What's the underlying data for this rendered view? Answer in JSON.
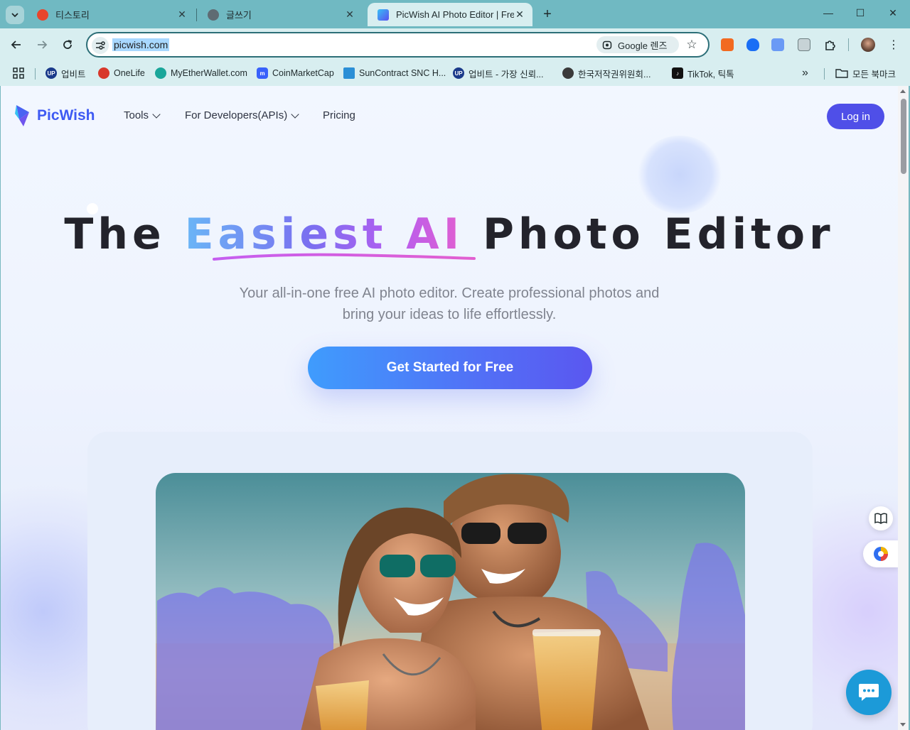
{
  "browser": {
    "tabs": [
      {
        "title": "티스토리",
        "favicon_color": "#e8452c"
      },
      {
        "title": "글쓰기",
        "favicon_color": "#5f6b73"
      },
      {
        "title": "PicWish AI Photo Editor | Free",
        "favicon_color": "#4f6df0"
      }
    ],
    "address": {
      "url": "picwish.com",
      "lens_label": "Google 렌즈"
    },
    "bookmarks": [
      {
        "label": "업비트",
        "icon_color": "#1a3a8a"
      },
      {
        "label": "OneLife",
        "icon_color": "#d8382b"
      },
      {
        "label": "MyEtherWallet.com",
        "icon_color": "#1aa69a"
      },
      {
        "label": "CoinMarketCap",
        "icon_color": "#3861fb"
      },
      {
        "label": "SunContract SNC H...",
        "icon_color": "#2b8fd6"
      },
      {
        "label": "업비트 - 가장 신뢰...",
        "icon_color": "#1a3a8a"
      },
      {
        "label": "한국저작권위원회...",
        "icon_color": "#3a3a3a"
      },
      {
        "label": "TikTok, 틱톡",
        "icon_color": "#111111"
      }
    ],
    "all_bookmarks_label": "모든 북마크"
  },
  "site": {
    "brand": "PicWish",
    "nav": {
      "tools": "Tools",
      "developers": "For Developers(APIs)",
      "pricing": "Pricing"
    },
    "login": "Log in",
    "hero": {
      "title_before": "The ",
      "title_highlight": "Easiest AI",
      "title_after": " Photo Editor",
      "subtitle_line1": "Your all-in-one free AI photo editor. Create professional photos and",
      "subtitle_line2": "bring your ideas to life effortlessly.",
      "cta": "Get Started for Free"
    }
  },
  "colors": {
    "brand_blue": "#3e5af3",
    "login_bg": "#4f4fe8",
    "chat_fab": "#1c9ad8"
  }
}
